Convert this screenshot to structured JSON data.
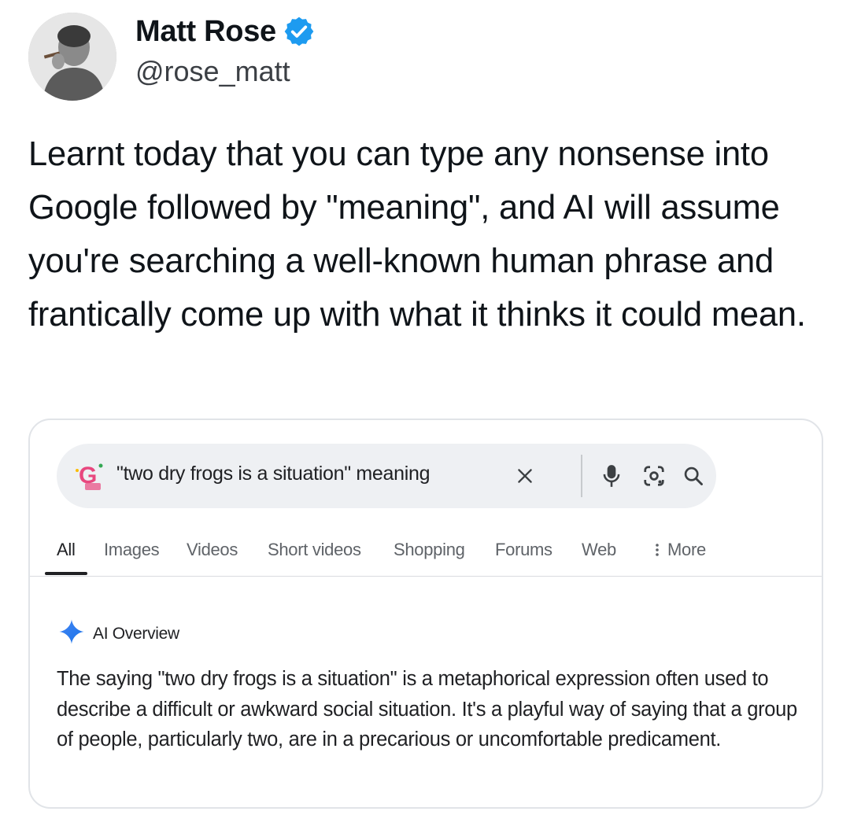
{
  "author": {
    "name": "Matt Rose",
    "handle": "@rose_matt",
    "verified_color": "#1d9bf0"
  },
  "tweet": {
    "text": "Learnt today that you can type any nonsense into Google followed by \"meaning\", and AI will assume you're searching a well-known human phrase and frantically come up with what it thinks it could mean."
  },
  "search": {
    "query": "\"two dry frogs is a situation\" meaning",
    "icons": [
      "google-doodle-icon",
      "clear-icon",
      "microphone-icon",
      "lens-icon",
      "search-icon"
    ]
  },
  "tabs": [
    {
      "label": "All",
      "active": true
    },
    {
      "label": "Images"
    },
    {
      "label": "Videos"
    },
    {
      "label": "Short videos"
    },
    {
      "label": "Shopping"
    },
    {
      "label": "Forums"
    },
    {
      "label": "Web"
    },
    {
      "label": "More"
    }
  ],
  "ai_overview": {
    "title": "AI Overview",
    "body": "The saying \"two dry frogs is a situation\" is a metaphorical expression often used to describe a difficult or awkward social situation. It's a playful way of saying that a group of people, particularly two, are in a precarious or uncomfortable predicament."
  }
}
